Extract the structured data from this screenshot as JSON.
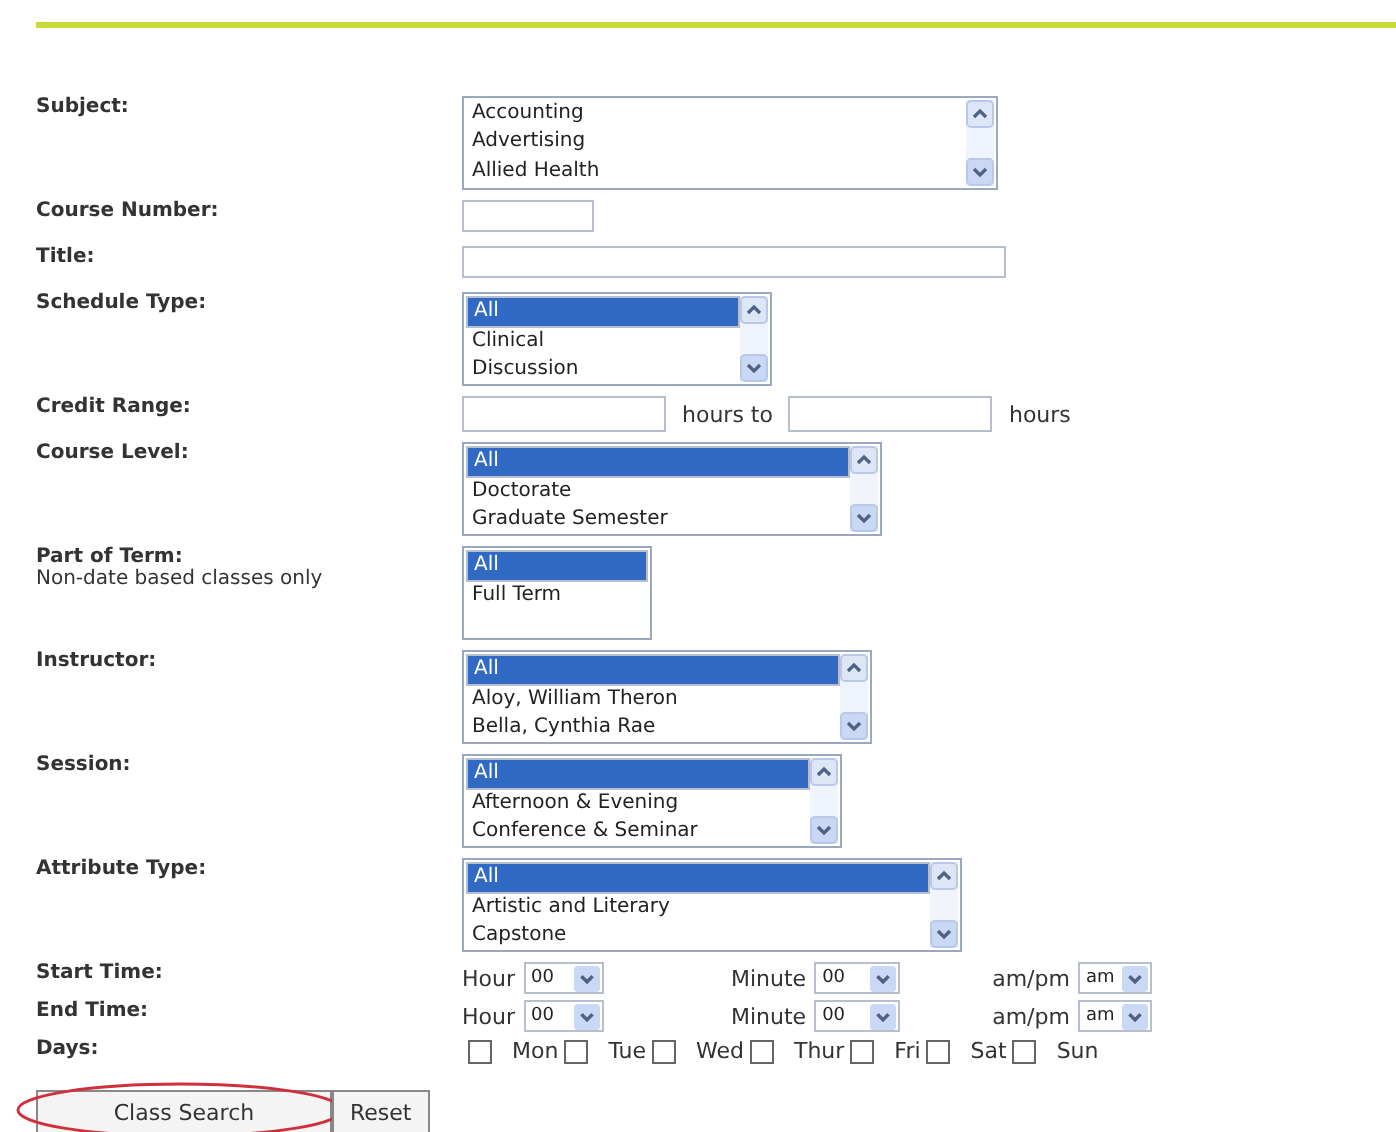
{
  "fields": [
    {
      "kind": "listbox",
      "label": "Subject:",
      "scrollbar": true,
      "options": [
        {
          "text": "Accounting",
          "selected": false
        },
        {
          "text": "Advertising",
          "selected": false
        },
        {
          "text": "Allied Health",
          "selected": false
        }
      ]
    },
    {
      "kind": "input",
      "label": "Course Number:"
    },
    {
      "kind": "input",
      "label": "Title:"
    },
    {
      "kind": "listbox",
      "label": "Schedule Type:",
      "scrollbar": true,
      "options": [
        {
          "text": "All",
          "selected": true
        },
        {
          "text": "Clinical",
          "selected": false
        },
        {
          "text": "Discussion",
          "selected": false
        }
      ]
    },
    {
      "kind": "range",
      "label": "Credit Range:",
      "middle": "hours to",
      "unit": "hours"
    },
    {
      "kind": "listbox",
      "label": "Course Level:",
      "scrollbar": true,
      "options": [
        {
          "text": "All",
          "selected": true
        },
        {
          "text": "Doctorate",
          "selected": false
        },
        {
          "text": "Graduate Semester",
          "selected": false
        }
      ]
    },
    {
      "kind": "listbox",
      "label": "Part of Term:",
      "note": "Non-date based classes only",
      "scrollbar": false,
      "options": [
        {
          "text": "All",
          "selected": true
        },
        {
          "text": "Full Term",
          "selected": false
        }
      ]
    },
    {
      "kind": "listbox",
      "label": "Instructor:",
      "scrollbar": true,
      "options": [
        {
          "text": "All",
          "selected": true
        },
        {
          "text": "Aloy, William Theron",
          "selected": false
        },
        {
          "text": "Bella, Cynthia Rae",
          "selected": false
        }
      ]
    },
    {
      "kind": "listbox",
      "label": "Session:",
      "scrollbar": true,
      "options": [
        {
          "text": "All",
          "selected": true
        },
        {
          "text": "Afternoon & Evening",
          "selected": false
        },
        {
          "text": "Conference & Seminar",
          "selected": false
        }
      ]
    },
    {
      "kind": "listbox",
      "label": "Attribute Type:",
      "scrollbar": true,
      "options": [
        {
          "text": "All",
          "selected": true
        },
        {
          "text": "Artistic and Literary",
          "selected": false
        },
        {
          "text": "Capstone",
          "selected": false
        }
      ]
    },
    {
      "kind": "time",
      "label": "Start Time:",
      "parts": [
        {
          "label": "Hour",
          "value": "00"
        },
        {
          "label": "Minute",
          "value": "00"
        },
        {
          "label": "am/pm",
          "value": "am"
        }
      ]
    },
    {
      "kind": "time",
      "label": "End Time:",
      "parts": [
        {
          "label": "Hour",
          "value": "00"
        },
        {
          "label": "Minute",
          "value": "00"
        },
        {
          "label": "am/pm",
          "value": "am"
        }
      ]
    },
    {
      "kind": "days",
      "label": "Days:",
      "days": [
        {
          "label": "Mon",
          "checked": false
        },
        {
          "label": "Tue",
          "checked": false
        },
        {
          "label": "Wed",
          "checked": false
        },
        {
          "label": "Thur",
          "checked": false
        },
        {
          "label": "Fri",
          "checked": false
        },
        {
          "label": "Sat",
          "checked": false
        },
        {
          "label": "Sun",
          "checked": false
        }
      ]
    }
  ],
  "buttons": [
    {
      "label": "Class Search",
      "circled": true
    },
    {
      "label": "Reset",
      "circled": false
    }
  ]
}
